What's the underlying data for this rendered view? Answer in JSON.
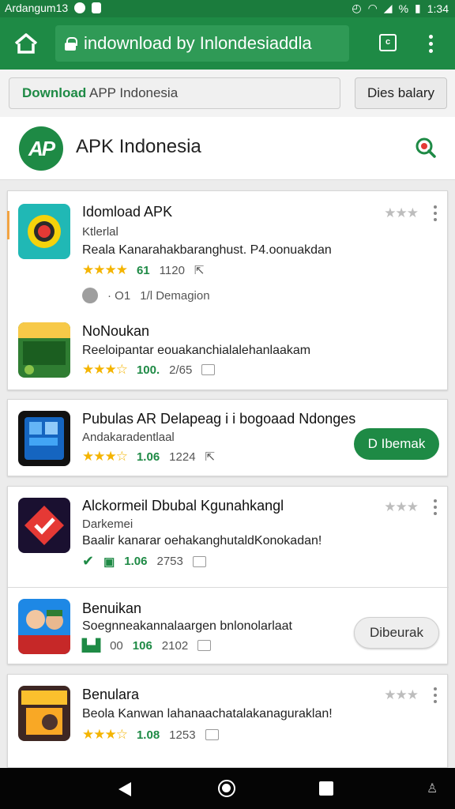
{
  "status_bar": {
    "carrier": "Ardangum13",
    "time": "1:34",
    "battery_label": "%"
  },
  "app_bar": {
    "url": "indownload by Inlondesiaddla",
    "tab_count": "c"
  },
  "search": {
    "label_bold": "Download",
    "label_rest": " APP Indonesia",
    "button": "Dies balary"
  },
  "site": {
    "logo_text": "AP",
    "name": "APK Indonesia"
  },
  "apps": [
    {
      "title": "Idomload APK",
      "subtitle": "Ktlerlal",
      "description": "Reala Kanarahakbaranghust. P4.oonuakdan",
      "rating": "61",
      "count": "1120",
      "extra_a": "· O1",
      "extra_b": "1/l Demagion"
    },
    {
      "title": "NoNoukan",
      "description": "Reeloipantar eouakanchialalehanlaakam",
      "rating": "100.",
      "count": "2/65"
    },
    {
      "title": "Pubulas AR Delapeag i i bogoaad Ndonges",
      "subtitle": "Andakaradentlaal",
      "rating": "1.06",
      "count": "1224",
      "button": "D Ibemak"
    },
    {
      "title": "Alckormeil Dbubal Kgunahkangl",
      "subtitle": "Darkemei",
      "description": "Baalir kanarar oehakanghutaldKonokadan!",
      "rating": "1.06",
      "count": "2753"
    },
    {
      "title": "Benuikan",
      "description": "Soegnneakannalaargen bnlonolarlaat",
      "rating": "106",
      "rating_prefix": "00",
      "count": "2102",
      "button": "Dibeurak"
    },
    {
      "title": "Benulara",
      "description": "Beola Kanwan lahanaachatalakanaguraklan!",
      "rating": "1.08",
      "count": "1253"
    }
  ],
  "colors": {
    "brand_green": "#1e8a45",
    "star_yellow": "#f4b400"
  },
  "icons": [
    "home-icon",
    "lock-icon",
    "tabs-icon",
    "menu-icon",
    "search-icon",
    "back-icon",
    "home-nav-icon",
    "recents-icon"
  ]
}
